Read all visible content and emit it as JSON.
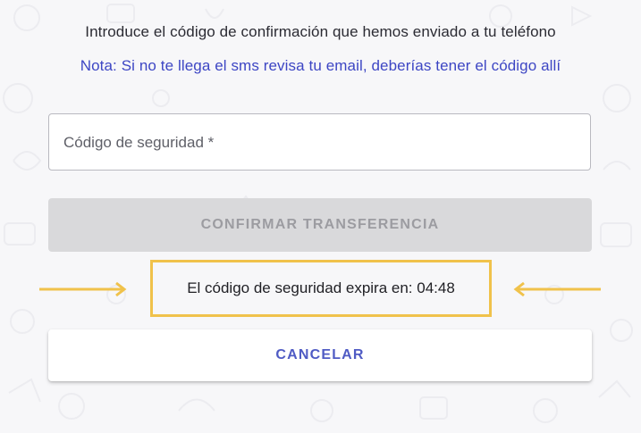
{
  "instruction_text": "Introduce el código de confirmación que hemos enviado a tu teléfono",
  "note_text": "Nota: Si no te llega el sms revisa tu email, deberías tener el código allí",
  "security_code_field": {
    "placeholder": "Código de seguridad *",
    "value": ""
  },
  "confirm_button_label": "CONFIRMAR TRANSFERENCIA",
  "expiry": {
    "text": "El código de seguridad expira en: 04:48"
  },
  "cancel_button_label": "CANCELAR",
  "colors": {
    "background": "#f7f7f9",
    "note_text": "#3d46c4",
    "highlight": "#f0c24b",
    "disabled_button": "#d9d9db",
    "cancel_text": "#4f5bc4"
  },
  "icons": [
    "arrow-right-icon",
    "arrow-left-icon"
  ]
}
